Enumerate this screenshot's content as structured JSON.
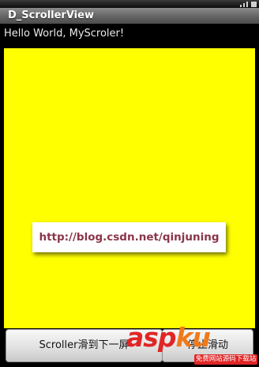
{
  "window": {
    "title": "D_ScrollerView"
  },
  "main": {
    "hello_text": "Hello World, MyScroler!",
    "scroller_color": "#ffff00",
    "url_text": "http://blog.csdn.net/qinjuning"
  },
  "buttons": {
    "next_label": "Scroller滑到下一屏",
    "stop_label": "停止滑动"
  },
  "watermark": {
    "logo_part1": "asp",
    "logo_part2": "ku",
    "tagline": "免费网站源码下载站"
  },
  "status_icons": [
    "signal-icon",
    "battery-icon"
  ]
}
